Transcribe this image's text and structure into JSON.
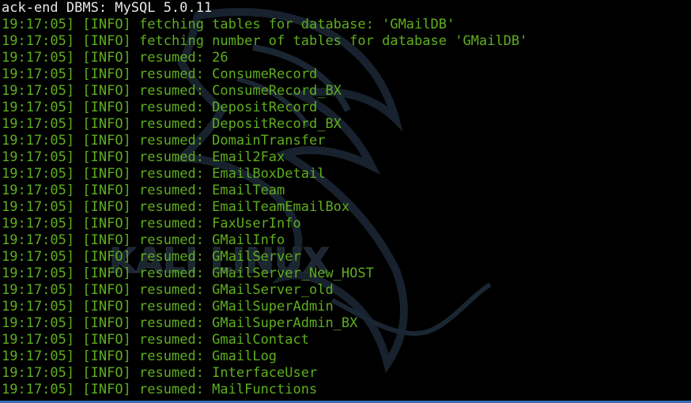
{
  "header_line": "ack-end DBMS: MySQL 5.0.11",
  "lines": [
    {
      "time": "19:17:05]",
      "level": "[INFO]",
      "msg": "fetching tables for database: 'GMailDB'"
    },
    {
      "time": "19:17:05]",
      "level": "[INFO]",
      "msg": "fetching number of tables for database 'GMailDB'"
    },
    {
      "time": "19:17:05]",
      "level": "[INFO]",
      "msg": "resumed: 26"
    },
    {
      "time": "19:17:05]",
      "level": "[INFO]",
      "msg": "resumed: ConsumeRecord"
    },
    {
      "time": "19:17:05]",
      "level": "[INFO]",
      "msg": "resumed: ConsumeRecord_BX"
    },
    {
      "time": "19:17:05]",
      "level": "[INFO]",
      "msg": "resumed: DepositRecord"
    },
    {
      "time": "19:17:05]",
      "level": "[INFO]",
      "msg": "resumed: DepositRecord_BX"
    },
    {
      "time": "19:17:05]",
      "level": "[INFO]",
      "msg": "resumed: DomainTransfer"
    },
    {
      "time": "19:17:05]",
      "level": "[INFO]",
      "msg": "resumed: Email2Fax"
    },
    {
      "time": "19:17:05]",
      "level": "[INFO]",
      "msg": "resumed: EmailBoxDetail"
    },
    {
      "time": "19:17:05]",
      "level": "[INFO]",
      "msg": "resumed: EmailTeam"
    },
    {
      "time": "19:17:05]",
      "level": "[INFO]",
      "msg": "resumed: EmailTeamEmailBox"
    },
    {
      "time": "19:17:05]",
      "level": "[INFO]",
      "msg": "resumed: FaxUserInfo"
    },
    {
      "time": "19:17:05]",
      "level": "[INFO]",
      "msg": "resumed: GMailInfo"
    },
    {
      "time": "19:17:05]",
      "level": "[INFO]",
      "msg": "resumed: GMailServer"
    },
    {
      "time": "19:17:05]",
      "level": "[INFO]",
      "msg": "resumed: GMailServer_New_HOST"
    },
    {
      "time": "19:17:05]",
      "level": "[INFO]",
      "msg": "resumed: GMailServer_old"
    },
    {
      "time": "19:17:05]",
      "level": "[INFO]",
      "msg": "resumed: GMailSuperAdmin"
    },
    {
      "time": "19:17:05]",
      "level": "[INFO]",
      "msg": "resumed: GMailSuperAdmin_BX"
    },
    {
      "time": "19:17:05]",
      "level": "[INFO]",
      "msg": "resumed: GmailContact"
    },
    {
      "time": "19:17:05]",
      "level": "[INFO]",
      "msg": "resumed: GmailLog"
    },
    {
      "time": "19:17:05]",
      "level": "[INFO]",
      "msg": "resumed: InterfaceUser"
    },
    {
      "time": "19:17:05]",
      "level": "[INFO]",
      "msg": "resumed: MailFunctions"
    }
  ],
  "watermark": {
    "logo_text": "KALI LINUX",
    "icon": "kali-dragon-icon"
  },
  "colors": {
    "background": "#000000",
    "log_text": "#5fae1e",
    "header_text": "#e8e8e8",
    "watermark": "#1c2630",
    "bottom_bar": "#3b6fb8"
  }
}
